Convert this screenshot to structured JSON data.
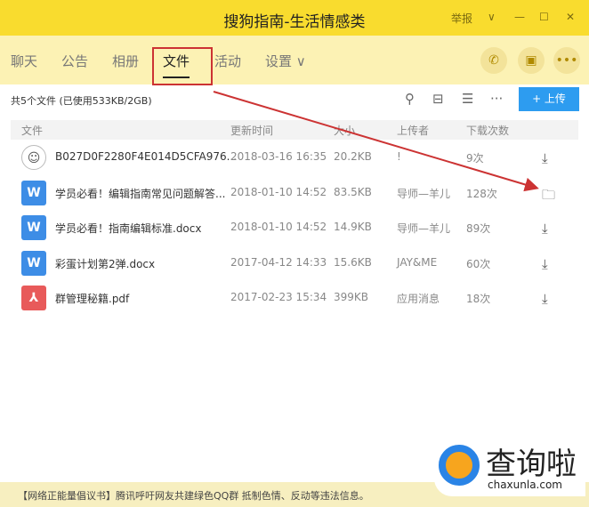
{
  "window": {
    "title": "搜狗指南-生活情感类",
    "report": "举报",
    "dropdown": "∨",
    "minimize": "—",
    "maximize": "☐",
    "close": "✕"
  },
  "tabs": [
    {
      "label": "聊天"
    },
    {
      "label": "公告"
    },
    {
      "label": "相册"
    },
    {
      "label": "文件"
    },
    {
      "label": "活动"
    },
    {
      "label": "设置 ∨"
    }
  ],
  "toolbar": {
    "summary": "共5个文件 (已使用533KB/2GB)",
    "upload": "+ 上传"
  },
  "columns": [
    "文件",
    "更新时间",
    "大小",
    "上传者",
    "下载次数"
  ],
  "files": [
    {
      "name": "B027D0F2280F4E014D5CFA976...",
      "time": "2018-03-16 16:35",
      "size": "20.2KB",
      "uploader": "!",
      "downloads": "9次",
      "type": "image",
      "action": "download"
    },
    {
      "name": "学员必看！编辑指南常见问题解答...",
      "time": "2018-01-10 14:52",
      "size": "83.5KB",
      "uploader": "导师—羊儿",
      "downloads": "128次",
      "type": "word",
      "action": "open-folder"
    },
    {
      "name": "学员必看！指南编辑标准.docx",
      "time": "2018-01-10 14:52",
      "size": "14.9KB",
      "uploader": "导师—羊儿",
      "downloads": "89次",
      "type": "word",
      "action": "download"
    },
    {
      "name": "彩蛋计划第2弹.docx",
      "time": "2017-04-12 14:33",
      "size": "15.6KB",
      "uploader": "JAY&ME",
      "downloads": "60次",
      "type": "word",
      "action": "download"
    },
    {
      "name": "群管理秘籍.pdf",
      "time": "2017-02-23 15:34",
      "size": "399KB",
      "uploader": "应用消息",
      "downloads": "18次",
      "type": "pdf",
      "action": "download"
    }
  ],
  "banner": {
    "text": "【网络正能量倡议书】腾讯呼吁网友共建绿色QQ群 抵制色情、反动等违法信息。",
    "close": "✕"
  },
  "watermark": {
    "cn": "查询啦",
    "domain": "chaxunla.com"
  },
  "colors": {
    "titlebar": "#f9dc2e",
    "accent": "#2d9cf0",
    "annotation": "#c33"
  }
}
